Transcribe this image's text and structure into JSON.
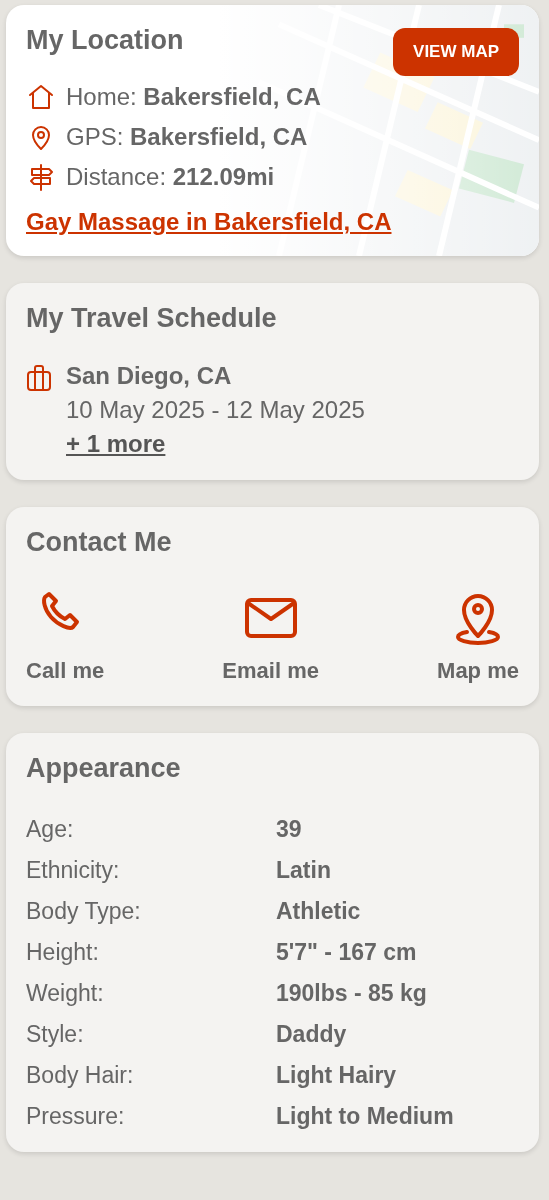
{
  "location": {
    "title": "My Location",
    "button": "VIEW MAP",
    "lines": [
      {
        "kind": "home",
        "text": "Home: **Bakersfield, CA**"
      },
      {
        "kind": "pin",
        "text": "GPS: **Bakersfield, CA**"
      },
      {
        "kind": "signpost",
        "text": "Distance: **212.09mi**"
      }
    ],
    "link": "Gay Massage in Bakersfield, CA"
  },
  "travel": {
    "title": "My Travel Schedule",
    "trips": [
      {
        "place": "San Diego, CA",
        "dates": "10 May 2025 - 12 May 2025"
      }
    ],
    "more": "+ 1 more"
  },
  "contact": {
    "title": "Contact Me",
    "actions": [
      {
        "kind": "phone",
        "label": "Call me"
      },
      {
        "kind": "email",
        "label": "Email me"
      },
      {
        "kind": "map",
        "label": "Map me"
      }
    ]
  },
  "appearance": {
    "title": "Appearance",
    "rows": [
      {
        "label": "Age:",
        "value": "39"
      },
      {
        "label": "Ethnicity:",
        "value": "Latin"
      },
      {
        "label": "Body Type:",
        "value": "Athletic"
      },
      {
        "label": "Height:",
        "value": "5'7\" - 167 cm"
      },
      {
        "label": "Weight:",
        "value": "190lbs - 85 kg"
      },
      {
        "label": "Style:",
        "value": "Daddy"
      },
      {
        "label": "Body Hair:",
        "value": "Light Hairy"
      },
      {
        "label": "Pressure:",
        "value": "Light to Medium"
      }
    ]
  }
}
